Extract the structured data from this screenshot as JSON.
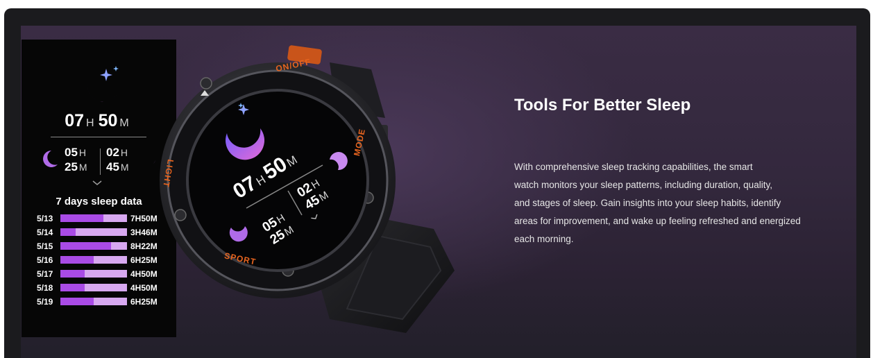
{
  "colors": {
    "accent_purple": "#a94be6",
    "bar_light": "#d7a8f0",
    "bezel_orange": "#e8651f",
    "banner_bg": "#33283d"
  },
  "panel": {
    "icon": "moon-stars-icon",
    "total_hours": "07",
    "total_hours_unit": "H",
    "total_minutes": "50",
    "total_minutes_unit": "M",
    "stage_a_hours": "05",
    "stage_a_hours_unit": "H",
    "stage_a_minutes": "25",
    "stage_a_minutes_unit": "M",
    "stage_b_hours": "02",
    "stage_b_hours_unit": "H",
    "stage_b_minutes": "45",
    "stage_b_minutes_unit": "M",
    "expand_icon": "chevron-down-icon",
    "history_title": "7 days sleep data",
    "history": [
      {
        "date": "5/13",
        "value": "7H50M",
        "fraction": 0.65
      },
      {
        "date": "5/14",
        "value": "3H46M",
        "fraction": 0.23
      },
      {
        "date": "5/15",
        "value": "8H22M",
        "fraction": 0.76
      },
      {
        "date": "5/16",
        "value": "6H25M",
        "fraction": 0.5
      },
      {
        "date": "5/17",
        "value": "4H50M",
        "fraction": 0.36
      },
      {
        "date": "5/18",
        "value": "4H50M",
        "fraction": 0.36
      },
      {
        "date": "5/19",
        "value": "6H25M",
        "fraction": 0.5
      }
    ]
  },
  "watch": {
    "bezel_onoff": "ON/OFF",
    "bezel_mode": "MODE",
    "bezel_light": "LIGHT",
    "bezel_sport": "SPORT",
    "face_hours": "07",
    "face_hours_unit": "H",
    "face_minutes": "50",
    "face_minutes_unit": "M",
    "face_a_hours": "05",
    "face_a_hours_unit": "H",
    "face_a_minutes": "25",
    "face_a_minutes_unit": "M",
    "face_b_hours": "02",
    "face_b_hours_unit": "H",
    "face_b_minutes": "45",
    "face_b_minutes_unit": "M"
  },
  "content": {
    "heading": "Tools For Better Sleep",
    "body_lines": [
      "With comprehensive sleep tracking capabilities, the smart",
      "watch monitors your sleep patterns, including duration, quality,",
      "and stages of sleep. Gain insights into your sleep habits, identify",
      "areas for improvement, and wake up feeling refreshed and energized",
      "each morning."
    ]
  }
}
